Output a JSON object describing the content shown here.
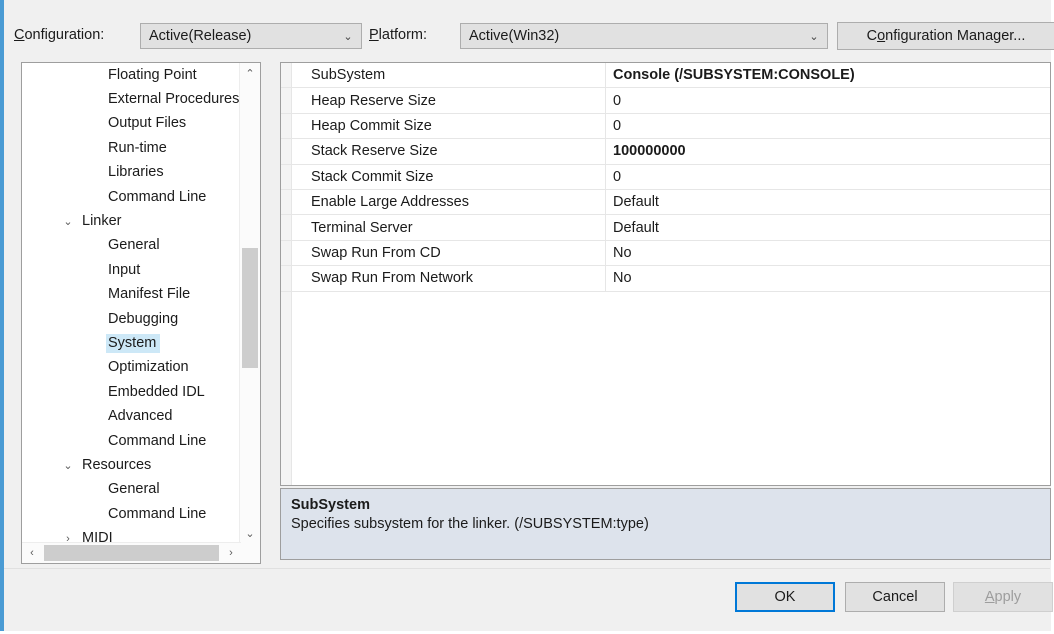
{
  "topbar": {
    "configuration_label": "Configuration:",
    "configuration_accel": "C",
    "configuration_value": "Active(Release)",
    "platform_label": "Platform:",
    "platform_accel": "P",
    "platform_value": "Active(Win32)",
    "config_manager_label": "Configuration Manager...",
    "config_manager_accel": "o",
    "dropdown_arrow": "⌄"
  },
  "tree": {
    "items": [
      {
        "label": "Floating Point",
        "level": 1,
        "chevron": "",
        "selected": false
      },
      {
        "label": "External Procedures",
        "level": 1,
        "chevron": "",
        "selected": false
      },
      {
        "label": "Output Files",
        "level": 1,
        "chevron": "",
        "selected": false
      },
      {
        "label": "Run-time",
        "level": 1,
        "chevron": "",
        "selected": false
      },
      {
        "label": "Libraries",
        "level": 1,
        "chevron": "",
        "selected": false
      },
      {
        "label": "Command Line",
        "level": 1,
        "chevron": "",
        "selected": false
      },
      {
        "label": "Linker",
        "level": 0,
        "chevron": "⌄",
        "selected": false
      },
      {
        "label": "General",
        "level": 1,
        "chevron": "",
        "selected": false
      },
      {
        "label": "Input",
        "level": 1,
        "chevron": "",
        "selected": false
      },
      {
        "label": "Manifest File",
        "level": 1,
        "chevron": "",
        "selected": false
      },
      {
        "label": "Debugging",
        "level": 1,
        "chevron": "",
        "selected": false
      },
      {
        "label": "System",
        "level": 1,
        "chevron": "",
        "selected": true
      },
      {
        "label": "Optimization",
        "level": 1,
        "chevron": "",
        "selected": false
      },
      {
        "label": "Embedded IDL",
        "level": 1,
        "chevron": "",
        "selected": false
      },
      {
        "label": "Advanced",
        "level": 1,
        "chevron": "",
        "selected": false
      },
      {
        "label": "Command Line",
        "level": 1,
        "chevron": "",
        "selected": false
      },
      {
        "label": "Resources",
        "level": 0,
        "chevron": "⌄",
        "selected": false
      },
      {
        "label": "General",
        "level": 1,
        "chevron": "",
        "selected": false
      },
      {
        "label": "Command Line",
        "level": 1,
        "chevron": "",
        "selected": false
      },
      {
        "label": "MIDI",
        "level": 0,
        "chevron": "›",
        "selected": false
      }
    ],
    "scroll": {
      "up_arrow": "⌃",
      "down_arrow": "⌄",
      "left_arrow": "‹",
      "right_arrow": "›"
    }
  },
  "grid": {
    "rows": [
      {
        "name": "SubSystem",
        "value": "Console (/SUBSYSTEM:CONSOLE)",
        "bold": true
      },
      {
        "name": "Heap Reserve Size",
        "value": "0",
        "bold": false
      },
      {
        "name": "Heap Commit Size",
        "value": "0",
        "bold": false
      },
      {
        "name": "Stack Reserve Size",
        "value": "100000000",
        "bold": true
      },
      {
        "name": "Stack Commit Size",
        "value": "0",
        "bold": false
      },
      {
        "name": "Enable Large Addresses",
        "value": "Default",
        "bold": false
      },
      {
        "name": "Terminal Server",
        "value": "Default",
        "bold": false
      },
      {
        "name": "Swap Run From CD",
        "value": "No",
        "bold": false
      },
      {
        "name": "Swap Run From Network",
        "value": "No",
        "bold": false
      }
    ]
  },
  "description": {
    "title": "SubSystem",
    "text": "Specifies subsystem for the linker. (/SUBSYSTEM:type)"
  },
  "footer": {
    "ok_label": "OK",
    "cancel_label": "Cancel",
    "apply_label": "Apply",
    "apply_accel": "A"
  },
  "colors": {
    "accent": "#0078d7",
    "selection": "#cde8f7",
    "description_bg": "#dde3ec",
    "window_edge": "#4a9bd4"
  }
}
